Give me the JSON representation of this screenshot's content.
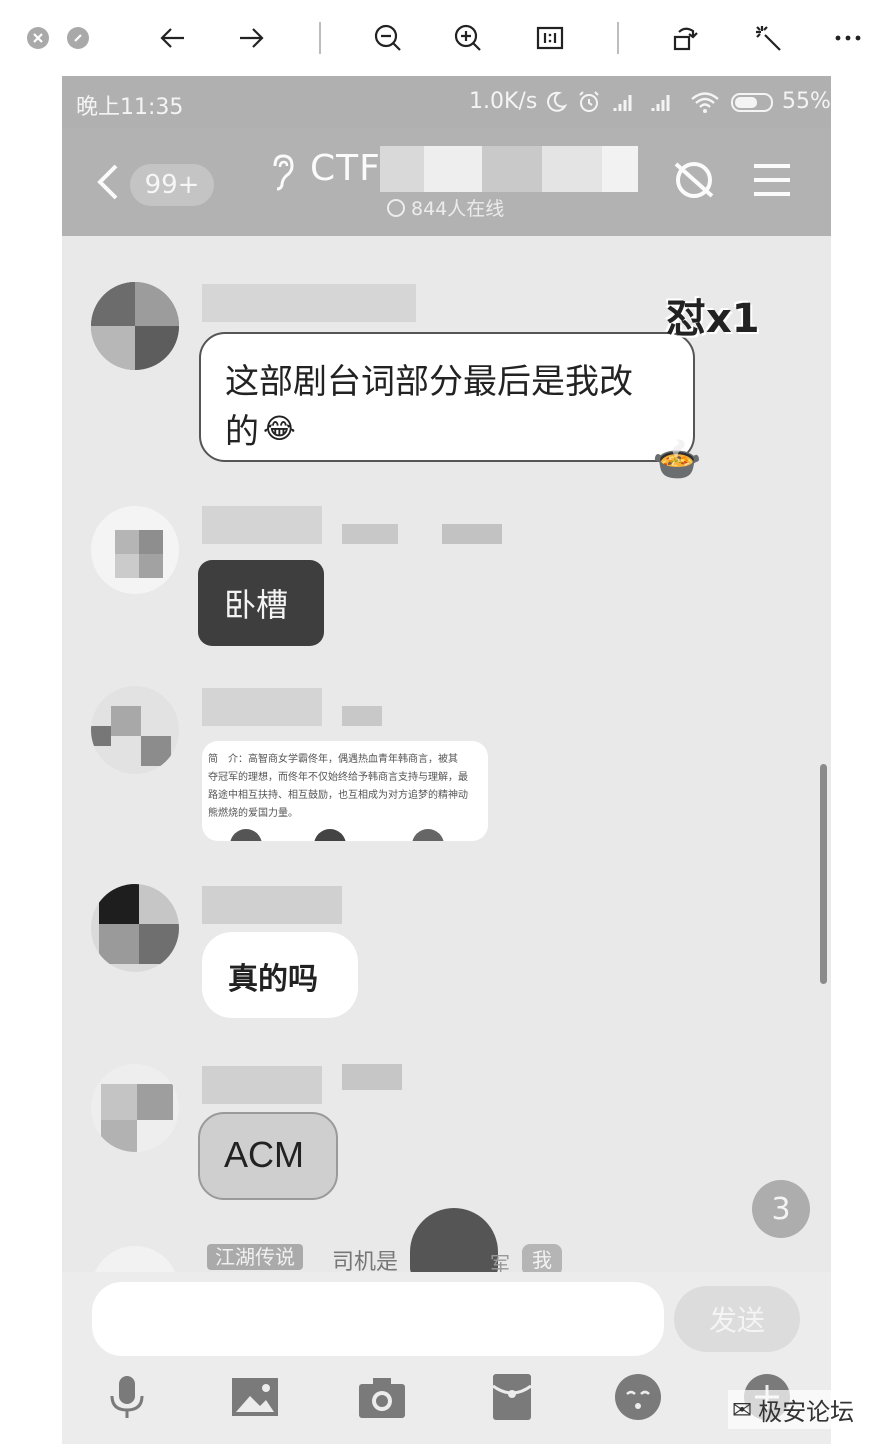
{
  "viewer": {
    "buttons": [
      "close",
      "minimize",
      "back",
      "forward",
      "zoom-out",
      "zoom-in",
      "actual-size",
      "rotate",
      "enhance",
      "more"
    ]
  },
  "status_bar": {
    "time": "晚上11:35",
    "net_speed": "1.0K/s",
    "battery": "55%"
  },
  "header": {
    "unread_count": "99+",
    "title_visible": "CTF",
    "online_count": "844人在线"
  },
  "messages": [
    {
      "type": "text",
      "text_line1": "这部剧台词部分最后是我改",
      "text_line2": "的",
      "badge": "怼x1"
    },
    {
      "type": "text",
      "text": "卧槽"
    },
    {
      "type": "image",
      "lines": [
        "简　介：高智商女学霸佟年，偶遇热血青年韩商言，被其",
        "夺冠军的理想，而佟年不仅始终给予韩商言支持与理解，最",
        "路途中相互扶持、相互鼓励，也互相成为对方追梦的精神动",
        "熊燃烧的爱国力量。"
      ]
    },
    {
      "type": "text",
      "text": "真的吗"
    },
    {
      "type": "text",
      "text": "ACM"
    },
    {
      "type": "partial",
      "title_tag": "江湖传说",
      "text": "司机是",
      "tail": "军",
      "me_tag": "我"
    }
  ],
  "new_msg_count": "3",
  "composer": {
    "placeholder": "",
    "send_label": "发送"
  },
  "watermark": "极安论坛"
}
